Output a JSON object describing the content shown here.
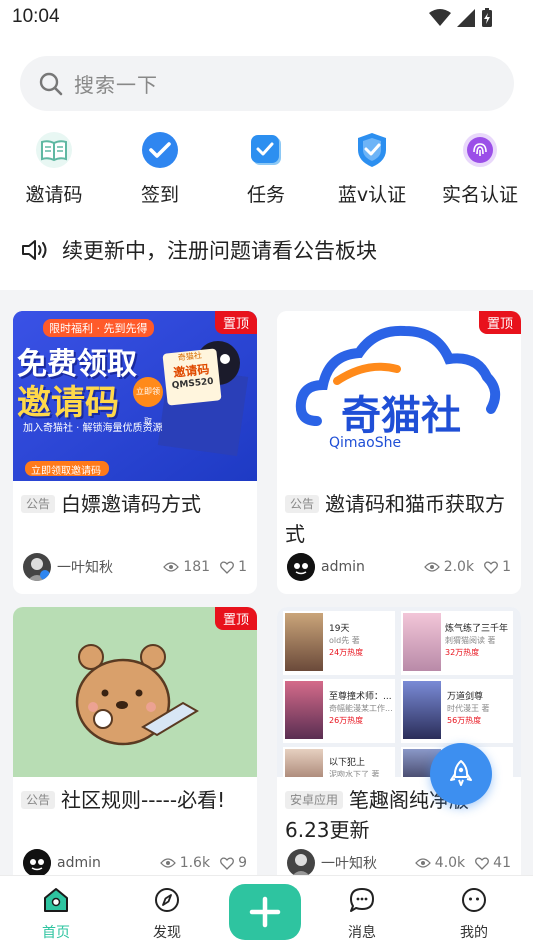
{
  "status_bar": {
    "time": "10:04"
  },
  "search": {
    "placeholder": "搜索一下"
  },
  "quick_actions": [
    {
      "label": "邀请码",
      "icon": "book-icon"
    },
    {
      "label": "签到",
      "icon": "check-circle-icon"
    },
    {
      "label": "任务",
      "icon": "task-check-icon"
    },
    {
      "label": "蓝v认证",
      "icon": "shield-check-icon"
    },
    {
      "label": "实名认证",
      "icon": "fingerprint-icon"
    }
  ],
  "notice": {
    "text": "续更新中，注册问题请看公告板块"
  },
  "posts": [
    {
      "pin": "置顶",
      "tag": "公告",
      "title": "白嫖邀请码方式",
      "author": "一叶知秋",
      "views": "181",
      "likes": "1",
      "image": {
        "top": "限时福利 · 先到先得",
        "line1": "免费领取",
        "line2": "邀请码",
        "sub": "加入奇猫社 · 解锁海量优质资源",
        "cta": "立即领取邀请码",
        "code_label": "奇猫社",
        "code_title": "邀请码",
        "code": "QMS520",
        "badge": "立即领取"
      }
    },
    {
      "pin": "置顶",
      "tag": "公告",
      "title": "邀请码和猫币获取方式",
      "author": "admin",
      "views": "2.0k",
      "likes": "1",
      "image": {
        "logo": "奇猫社",
        "logo_en": "QimaoShe"
      }
    },
    {
      "pin": "置顶",
      "tag": "公告",
      "title": "社区规则-----必看!",
      "author": "admin",
      "views": "1.6k",
      "likes": "9"
    },
    {
      "pin": "",
      "tag": "安卓应用",
      "title": "笔趣阁纯净版6.23更新",
      "author": "一叶知秋",
      "views": "4.0k",
      "likes": "41",
      "books": [
        {
          "title": "19天",
          "author": "old先 著",
          "heat": "24万热度"
        },
        {
          "title": "炼气练了三千年",
          "author": "刺猬猫阅读 著",
          "heat": "32万热度"
        },
        {
          "title": "至尊撞术师：...",
          "author": "奇幅能漫某工作...",
          "heat": "26万热度"
        },
        {
          "title": "万道剑尊",
          "author": "时代漫王 著",
          "heat": "56万热度"
        },
        {
          "title": "以下犯上",
          "author": "泥吻水下了 著",
          "heat": ""
        },
        {
          "title": "",
          "author": "",
          "heat": ""
        }
      ]
    }
  ],
  "tabbar": {
    "items": [
      {
        "label": "首页",
        "icon": "home-icon",
        "active": true
      },
      {
        "label": "发现",
        "icon": "compass-icon",
        "active": false
      },
      {
        "label": "消息",
        "icon": "chat-icon",
        "active": false
      },
      {
        "label": "我的",
        "icon": "profile-icon",
        "active": false
      }
    ]
  },
  "colors": {
    "accent": "#2ec4a0",
    "pin": "#e8121c",
    "rocket": "#3d8ff0"
  }
}
